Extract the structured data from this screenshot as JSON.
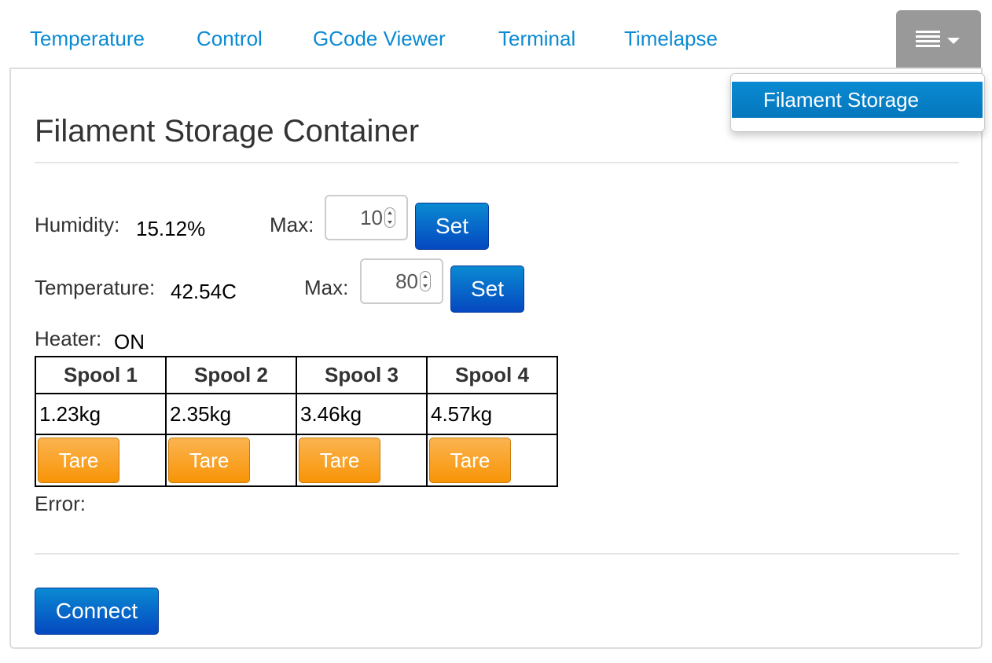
{
  "tabs": [
    "Temperature",
    "Control",
    "GCode Viewer",
    "Terminal",
    "Timelapse"
  ],
  "menu": {
    "items": [
      "Filament Storage"
    ]
  },
  "panel": {
    "title": "Filament Storage Container",
    "humidity": {
      "label": "Humidity:",
      "value": "15.12%",
      "max_label": "Max:",
      "max_value": "10",
      "set_label": "Set"
    },
    "temperature": {
      "label": "Temperature:",
      "value": "42.54C",
      "max_label": "Max:",
      "max_value": "80",
      "set_label": "Set"
    },
    "heater": {
      "label": "Heater:",
      "value": "ON"
    },
    "spools": {
      "headers": [
        "Spool 1",
        "Spool 2",
        "Spool 3",
        "Spool 4"
      ],
      "weights": [
        "1.23kg",
        "2.35kg",
        "3.46kg",
        "4.57kg"
      ],
      "tare_label": "Tare"
    },
    "error_label": "Error:",
    "connect_label": "Connect"
  },
  "colors": {
    "link": "#0a8ad2",
    "primary_button": "#0548c0",
    "tare_button": "#f89406",
    "menu_toggle": "#999999"
  }
}
